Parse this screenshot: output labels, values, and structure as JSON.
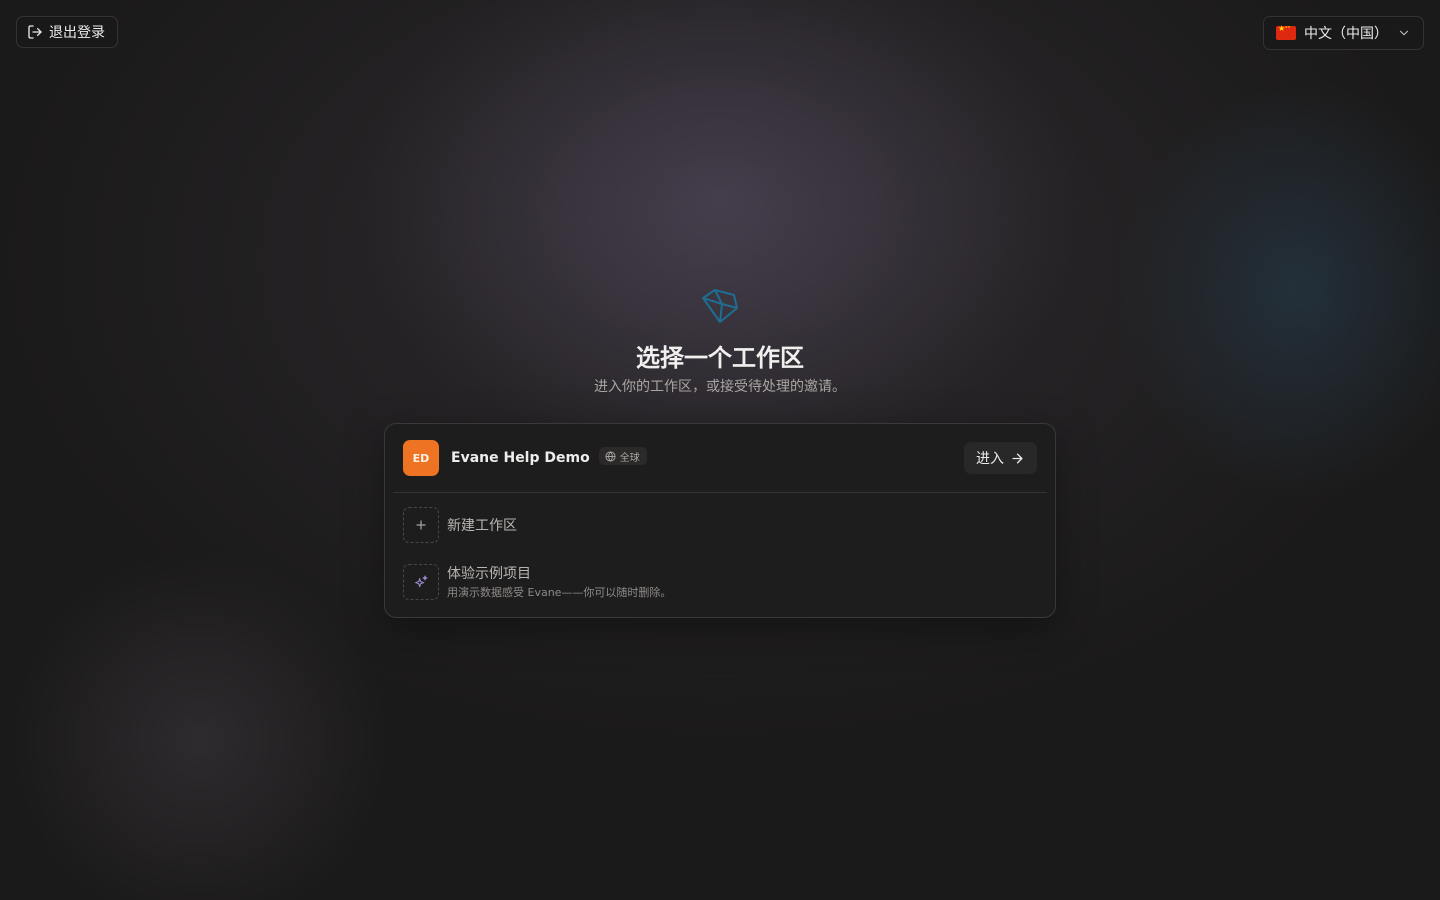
{
  "header": {
    "logout_label": "退出登录",
    "language": "中文（中国）"
  },
  "main": {
    "title": "选择一个工作区",
    "subtitle": "进入你的工作区，或接受待处理的邀请。"
  },
  "workspace": {
    "initials": "ED",
    "name": "Evane Help Demo",
    "badge": "全球",
    "enter_label": "进入"
  },
  "options": {
    "new_workspace": "新建工作区",
    "demo_title": "体验示例项目",
    "demo_desc": "用演示数据感受 Evane——你可以随时删除。"
  },
  "colors": {
    "workspace_avatar": "#ee7322",
    "logo_accent": "#1f6e92",
    "demo_icon": "#9d8bd0"
  },
  "icons": {
    "logout": "log-out-icon",
    "flag": "china-flag-icon",
    "chevron": "chevron-down-icon",
    "logo": "app-logo-icon",
    "globe": "globe-icon",
    "arrow": "arrow-right-icon",
    "plus": "plus-icon",
    "sparkles": "sparkles-icon"
  }
}
